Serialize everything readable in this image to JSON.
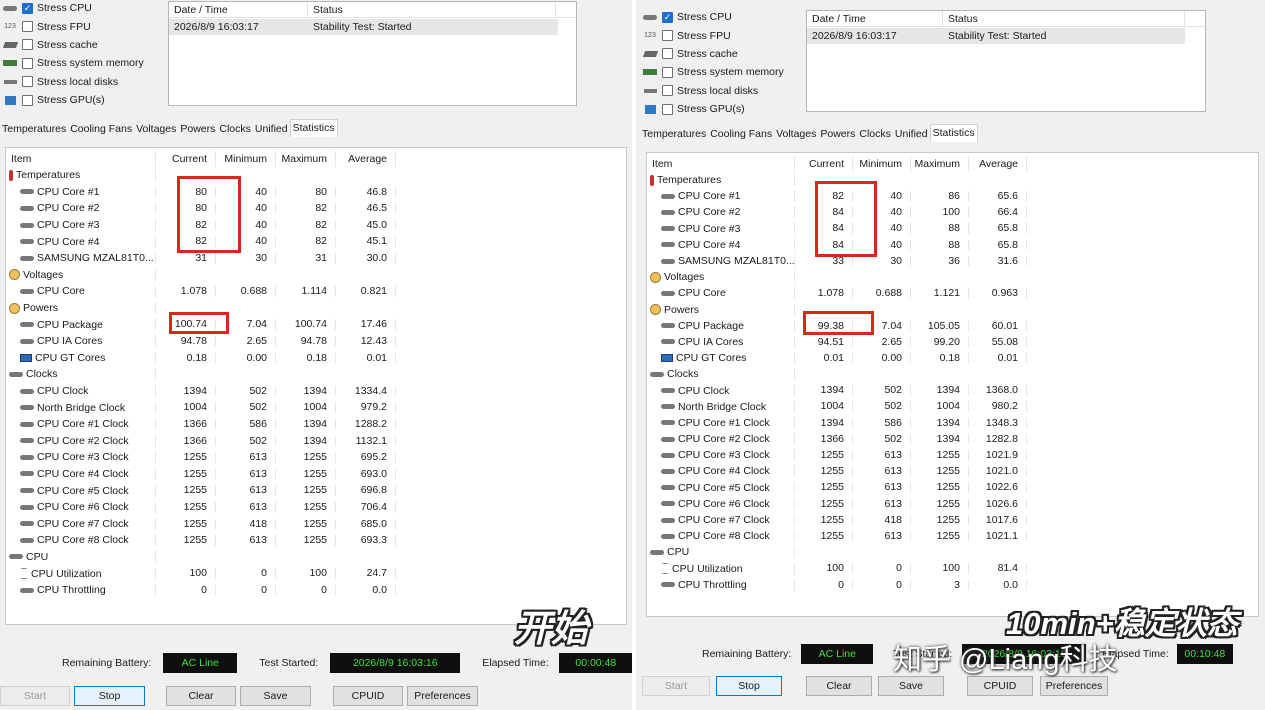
{
  "left": {
    "stress": [
      {
        "label": "Stress CPU",
        "checked": true,
        "icon": "cpu-icon"
      },
      {
        "label": "Stress FPU",
        "checked": false,
        "icon": "fpu-icon"
      },
      {
        "label": "Stress cache",
        "checked": false,
        "icon": "cache-icon"
      },
      {
        "label": "Stress system memory",
        "checked": false,
        "icon": "memory-icon"
      },
      {
        "label": "Stress local disks",
        "checked": false,
        "icon": "disk-icon"
      },
      {
        "label": "Stress GPU(s)",
        "checked": false,
        "icon": "gpu-icon"
      }
    ],
    "log": {
      "headers": [
        "Date / Time",
        "Status"
      ],
      "rows": [
        [
          "2026/8/9 16:03:17",
          "Stability Test: Started"
        ]
      ]
    },
    "tabs": [
      "Temperatures",
      "Cooling Fans",
      "Voltages",
      "Powers",
      "Clocks",
      "Unified",
      "Statistics"
    ],
    "active_tab": "Statistics",
    "table": {
      "headers": [
        "Item",
        "Current",
        "Minimum",
        "Maximum",
        "Average"
      ],
      "rows": [
        {
          "type": "section",
          "icon": "thermometer-icon",
          "label": "Temperatures"
        },
        {
          "type": "sensor",
          "icon": "cpu-core-icon",
          "label": "CPU Core #1",
          "vals": [
            "80",
            "40",
            "80",
            "46.8"
          ]
        },
        {
          "type": "sensor",
          "icon": "cpu-core-icon",
          "label": "CPU Core #2",
          "vals": [
            "80",
            "40",
            "82",
            "46.5"
          ]
        },
        {
          "type": "sensor",
          "icon": "cpu-core-icon",
          "label": "CPU Core #3",
          "vals": [
            "82",
            "40",
            "82",
            "45.0"
          ]
        },
        {
          "type": "sensor",
          "icon": "cpu-core-icon",
          "label": "CPU Core #4",
          "vals": [
            "82",
            "40",
            "82",
            "45.1"
          ]
        },
        {
          "type": "sensor",
          "icon": "disk-icon",
          "label": "SAMSUNG MZAL81T0...",
          "vals": [
            "31",
            "30",
            "31",
            "30.0"
          ]
        },
        {
          "type": "section",
          "icon": "voltage-icon",
          "label": "Voltages"
        },
        {
          "type": "sensor",
          "icon": "cpu-core-icon",
          "label": "CPU Core",
          "vals": [
            "1.078",
            "0.688",
            "1.114",
            "0.821"
          ]
        },
        {
          "type": "section",
          "icon": "power-icon",
          "label": "Powers"
        },
        {
          "type": "sensor",
          "icon": "cpu-core-icon",
          "label": "CPU Package",
          "vals": [
            "100.74",
            "7.04",
            "100.74",
            "17.46"
          ]
        },
        {
          "type": "sensor",
          "icon": "cpu-core-icon",
          "label": "CPU IA Cores",
          "vals": [
            "94.78",
            "2.65",
            "94.78",
            "12.43"
          ]
        },
        {
          "type": "sensor",
          "icon": "gpu-chip-icon",
          "label": "CPU GT Cores",
          "vals": [
            "0.18",
            "0.00",
            "0.18",
            "0.01"
          ]
        },
        {
          "type": "section",
          "icon": "clock-icon",
          "label": "Clocks"
        },
        {
          "type": "sensor",
          "icon": "cpu-core-icon",
          "label": "CPU Clock",
          "vals": [
            "1394",
            "502",
            "1394",
            "1334.4"
          ]
        },
        {
          "type": "sensor",
          "icon": "bridge-icon",
          "label": "North Bridge Clock",
          "vals": [
            "1004",
            "502",
            "1004",
            "979.2"
          ]
        },
        {
          "type": "sensor",
          "icon": "cpu-core-icon",
          "label": "CPU Core #1 Clock",
          "vals": [
            "1366",
            "586",
            "1394",
            "1288.2"
          ]
        },
        {
          "type": "sensor",
          "icon": "cpu-core-icon",
          "label": "CPU Core #2 Clock",
          "vals": [
            "1366",
            "502",
            "1394",
            "1132.1"
          ]
        },
        {
          "type": "sensor",
          "icon": "cpu-core-icon",
          "label": "CPU Core #3 Clock",
          "vals": [
            "1255",
            "613",
            "1255",
            "695.2"
          ]
        },
        {
          "type": "sensor",
          "icon": "cpu-core-icon",
          "label": "CPU Core #4 Clock",
          "vals": [
            "1255",
            "613",
            "1255",
            "693.0"
          ]
        },
        {
          "type": "sensor",
          "icon": "cpu-core-icon",
          "label": "CPU Core #5 Clock",
          "vals": [
            "1255",
            "613",
            "1255",
            "696.8"
          ]
        },
        {
          "type": "sensor",
          "icon": "cpu-core-icon",
          "label": "CPU Core #6 Clock",
          "vals": [
            "1255",
            "613",
            "1255",
            "706.4"
          ]
        },
        {
          "type": "sensor",
          "icon": "cpu-core-icon",
          "label": "CPU Core #7 Clock",
          "vals": [
            "1255",
            "418",
            "1255",
            "685.0"
          ]
        },
        {
          "type": "sensor",
          "icon": "cpu-core-icon",
          "label": "CPU Core #8 Clock",
          "vals": [
            "1255",
            "613",
            "1255",
            "693.3"
          ]
        },
        {
          "type": "section",
          "icon": "cpu-icon",
          "label": "CPU"
        },
        {
          "type": "sensor",
          "icon": "hourglass-icon",
          "label": "CPU Utilization",
          "vals": [
            "100",
            "0",
            "100",
            "24.7"
          ]
        },
        {
          "type": "sensor",
          "icon": "cpu-core-icon",
          "label": "CPU Throttling",
          "vals": [
            "0",
            "0",
            "0",
            "0.0"
          ]
        }
      ]
    },
    "caption": "开始",
    "status": {
      "battery_label": "Remaining Battery:",
      "battery_value": "AC Line",
      "started_label": "Test Started:",
      "started_value": "2026/8/9 16:03:16",
      "elapsed_label": "Elapsed Time:",
      "elapsed_value": "00:00:48"
    },
    "buttons": {
      "start": "Start",
      "stop": "Stop",
      "clear": "Clear",
      "save": "Save",
      "cpuid": "CPUID",
      "preferences": "Preferences"
    }
  },
  "right": {
    "stress": [
      {
        "label": "Stress CPU",
        "checked": true,
        "icon": "cpu-icon"
      },
      {
        "label": "Stress FPU",
        "checked": false,
        "icon": "fpu-icon"
      },
      {
        "label": "Stress cache",
        "checked": false,
        "icon": "cache-icon"
      },
      {
        "label": "Stress system memory",
        "checked": false,
        "icon": "memory-icon"
      },
      {
        "label": "Stress local disks",
        "checked": false,
        "icon": "disk-icon"
      },
      {
        "label": "Stress GPU(s)",
        "checked": false,
        "icon": "gpu-icon"
      }
    ],
    "log": {
      "headers": [
        "Date / Time",
        "Status"
      ],
      "rows": [
        [
          "2026/8/9 16:03:17",
          "Stability Test: Started"
        ]
      ]
    },
    "tabs": [
      "Temperatures",
      "Cooling Fans",
      "Voltages",
      "Powers",
      "Clocks",
      "Unified",
      "Statistics"
    ],
    "active_tab": "Statistics",
    "table": {
      "headers": [
        "Item",
        "Current",
        "Minimum",
        "Maximum",
        "Average"
      ],
      "rows": [
        {
          "type": "section",
          "icon": "thermometer-icon",
          "label": "Temperatures"
        },
        {
          "type": "sensor",
          "icon": "cpu-core-icon",
          "label": "CPU Core #1",
          "vals": [
            "82",
            "40",
            "86",
            "65.6"
          ]
        },
        {
          "type": "sensor",
          "icon": "cpu-core-icon",
          "label": "CPU Core #2",
          "vals": [
            "84",
            "40",
            "100",
            "66.4"
          ]
        },
        {
          "type": "sensor",
          "icon": "cpu-core-icon",
          "label": "CPU Core #3",
          "vals": [
            "84",
            "40",
            "88",
            "65.8"
          ]
        },
        {
          "type": "sensor",
          "icon": "cpu-core-icon",
          "label": "CPU Core #4",
          "vals": [
            "84",
            "40",
            "88",
            "65.8"
          ]
        },
        {
          "type": "sensor",
          "icon": "disk-icon",
          "label": "SAMSUNG MZAL81T0...",
          "vals": [
            "33",
            "30",
            "36",
            "31.6"
          ]
        },
        {
          "type": "section",
          "icon": "voltage-icon",
          "label": "Voltages"
        },
        {
          "type": "sensor",
          "icon": "cpu-core-icon",
          "label": "CPU Core",
          "vals": [
            "1.078",
            "0.688",
            "1.121",
            "0.963"
          ]
        },
        {
          "type": "section",
          "icon": "power-icon",
          "label": "Powers"
        },
        {
          "type": "sensor",
          "icon": "cpu-core-icon",
          "label": "CPU Package",
          "vals": [
            "99.38",
            "7.04",
            "105.05",
            "60.01"
          ]
        },
        {
          "type": "sensor",
          "icon": "cpu-core-icon",
          "label": "CPU IA Cores",
          "vals": [
            "94.51",
            "2.65",
            "99.20",
            "55.08"
          ]
        },
        {
          "type": "sensor",
          "icon": "gpu-chip-icon",
          "label": "CPU GT Cores",
          "vals": [
            "0.01",
            "0.00",
            "0.18",
            "0.01"
          ]
        },
        {
          "type": "section",
          "icon": "clock-icon",
          "label": "Clocks"
        },
        {
          "type": "sensor",
          "icon": "cpu-core-icon",
          "label": "CPU Clock",
          "vals": [
            "1394",
            "502",
            "1394",
            "1368.0"
          ]
        },
        {
          "type": "sensor",
          "icon": "bridge-icon",
          "label": "North Bridge Clock",
          "vals": [
            "1004",
            "502",
            "1004",
            "980.2"
          ]
        },
        {
          "type": "sensor",
          "icon": "cpu-core-icon",
          "label": "CPU Core #1 Clock",
          "vals": [
            "1394",
            "586",
            "1394",
            "1348.3"
          ]
        },
        {
          "type": "sensor",
          "icon": "cpu-core-icon",
          "label": "CPU Core #2 Clock",
          "vals": [
            "1366",
            "502",
            "1394",
            "1282.8"
          ]
        },
        {
          "type": "sensor",
          "icon": "cpu-core-icon",
          "label": "CPU Core #3 Clock",
          "vals": [
            "1255",
            "613",
            "1255",
            "1021.9"
          ]
        },
        {
          "type": "sensor",
          "icon": "cpu-core-icon",
          "label": "CPU Core #4 Clock",
          "vals": [
            "1255",
            "613",
            "1255",
            "1021.0"
          ]
        },
        {
          "type": "sensor",
          "icon": "cpu-core-icon",
          "label": "CPU Core #5 Clock",
          "vals": [
            "1255",
            "613",
            "1255",
            "1022.6"
          ]
        },
        {
          "type": "sensor",
          "icon": "cpu-core-icon",
          "label": "CPU Core #6 Clock",
          "vals": [
            "1255",
            "613",
            "1255",
            "1026.6"
          ]
        },
        {
          "type": "sensor",
          "icon": "cpu-core-icon",
          "label": "CPU Core #7 Clock",
          "vals": [
            "1255",
            "418",
            "1255",
            "1017.6"
          ]
        },
        {
          "type": "sensor",
          "icon": "cpu-core-icon",
          "label": "CPU Core #8 Clock",
          "vals": [
            "1255",
            "613",
            "1255",
            "1021.1"
          ]
        },
        {
          "type": "section",
          "icon": "cpu-icon",
          "label": "CPU"
        },
        {
          "type": "sensor",
          "icon": "hourglass-icon",
          "label": "CPU Utilization",
          "vals": [
            "100",
            "0",
            "100",
            "81.4"
          ]
        },
        {
          "type": "sensor",
          "icon": "cpu-core-icon",
          "label": "CPU Throttling",
          "vals": [
            "0",
            "0",
            "3",
            "0.0"
          ]
        }
      ]
    },
    "caption": "10min+稳定状态",
    "status": {
      "battery_label": "Remaining Battery:",
      "battery_value": "AC Line",
      "started_label": "Test Started:",
      "started_value": "2026/8/9 16:03:16",
      "elapsed_label": "Elapsed Time:",
      "elapsed_value": "00:10:48"
    },
    "buttons": {
      "start": "Start",
      "stop": "Stop",
      "clear": "Clear",
      "save": "Save",
      "cpuid": "CPUID",
      "preferences": "Preferences"
    }
  },
  "watermark": "知乎 @Liang科技",
  "colors": {
    "highlight": "#d9291c",
    "status_bg": "#0f0f0f",
    "status_fg": "#3ee13b",
    "checkbox_checked": "#1e6fd0"
  }
}
